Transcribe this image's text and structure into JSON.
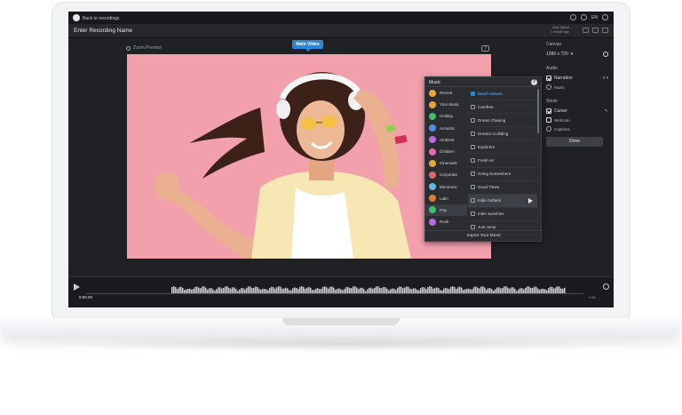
{
  "app": {
    "back_label": "Back to recordings",
    "language": "EN",
    "recording_name": "Enter Recording Name",
    "saved_status": "Auto Saved",
    "saved_time": "1 minute ago"
  },
  "preview": {
    "tab_label": "Main Video",
    "zoom_label": "Zoom Preview",
    "help_glyph": "?"
  },
  "music_panel": {
    "title": "Music",
    "help_glyph": "?",
    "categories": [
      {
        "label": "Recent",
        "color": "#e0a93a"
      },
      {
        "label": "Your Music",
        "color": "#e0a93a"
      },
      {
        "label": "Holiday",
        "color": "#3fbf6a"
      },
      {
        "label": "Acoustic",
        "color": "#4e8de0"
      },
      {
        "label": "Ambient",
        "color": "#b86be0"
      },
      {
        "label": "Children",
        "color": "#e06bb0"
      },
      {
        "label": "Cinematic",
        "color": "#e0a93a"
      },
      {
        "label": "Corporate",
        "color": "#d86a6a"
      },
      {
        "label": "Electronic",
        "color": "#6ab6e0"
      },
      {
        "label": "Latin",
        "color": "#e07a3a"
      },
      {
        "label": "Pop",
        "color": "#3fbf6a"
      },
      {
        "label": "Rock",
        "color": "#b86be0"
      }
    ],
    "active_category": "Pop",
    "songs": [
      {
        "label": "Beach Waves",
        "selected": true
      },
      {
        "label": "Carefree",
        "selected": false
      },
      {
        "label": "Dream Chasing",
        "selected": false
      },
      {
        "label": "Dreams Colliding",
        "selected": false
      },
      {
        "label": "Explorers",
        "selected": false
      },
      {
        "label": "Fresh Air",
        "selected": false
      },
      {
        "label": "Going Somewhere",
        "selected": false
      },
      {
        "label": "Good Times",
        "selected": false
      },
      {
        "label": "Indie Anthem",
        "selected": false,
        "hover": true
      },
      {
        "label": "Indie Sunshine",
        "selected": false
      },
      {
        "label": "Just Jump",
        "selected": false
      }
    ],
    "import_label": "Import Your Music"
  },
  "settings": {
    "canvas_heading": "Canvas",
    "canvas_size": "1280 x 720",
    "audio_heading": "Audio",
    "narration_label": "Narration",
    "narration_checked": true,
    "music_label": "Music",
    "show_heading": "Show",
    "cursor_label": "Cursor",
    "cursor_checked": true,
    "webcam_label": "Webcam",
    "webcam_checked": false,
    "captions_label": "Captions",
    "done_label": "Done"
  },
  "timeline": {
    "current_time": "0:00.00",
    "end_time": "0:51"
  },
  "colors": {
    "accent": "#2a86d9",
    "video_background": "#f3a0ad",
    "app_background": "#1f2124"
  }
}
